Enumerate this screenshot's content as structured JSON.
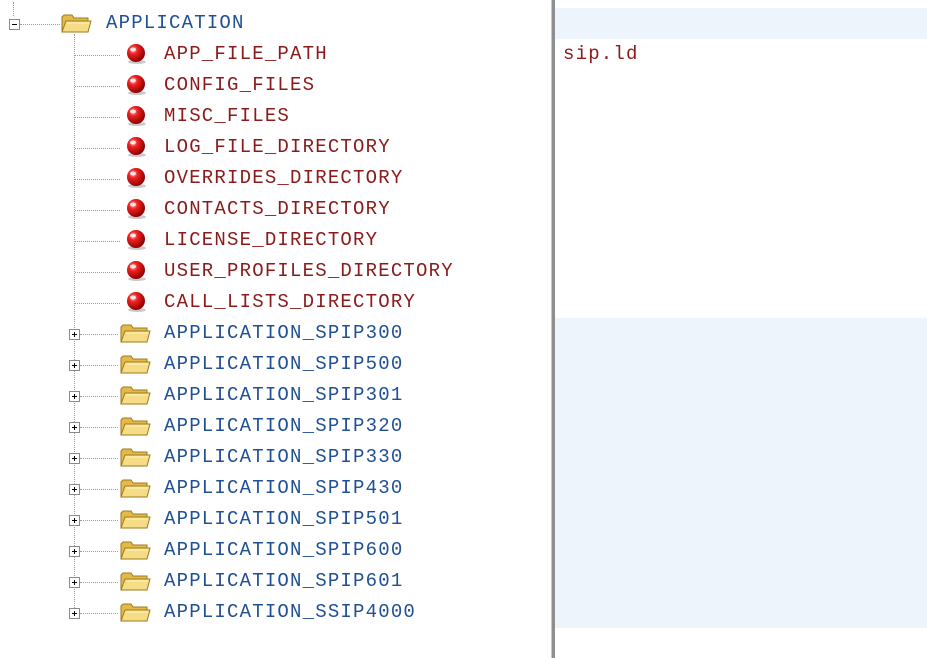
{
  "tree": {
    "root": {
      "label": "APPLICATION",
      "expanded": true,
      "icon": "folder-icon"
    },
    "parameters": [
      {
        "label": "APP_FILE_PATH",
        "icon": "red-ball-icon",
        "value": "sip.ld"
      },
      {
        "label": "CONFIG_FILES",
        "icon": "red-ball-icon",
        "value": ""
      },
      {
        "label": "MISC_FILES",
        "icon": "red-ball-icon",
        "value": ""
      },
      {
        "label": "LOG_FILE_DIRECTORY",
        "icon": "red-ball-icon",
        "value": ""
      },
      {
        "label": "OVERRIDES_DIRECTORY",
        "icon": "red-ball-icon",
        "value": ""
      },
      {
        "label": "CONTACTS_DIRECTORY",
        "icon": "red-ball-icon",
        "value": ""
      },
      {
        "label": "LICENSE_DIRECTORY",
        "icon": "red-ball-icon",
        "value": ""
      },
      {
        "label": "USER_PROFILES_DIRECTORY",
        "icon": "red-ball-icon",
        "value": ""
      },
      {
        "label": "CALL_LISTS_DIRECTORY",
        "icon": "red-ball-icon",
        "value": ""
      }
    ],
    "subfolders": [
      {
        "label": "APPLICATION_SPIP300",
        "expanded": false,
        "icon": "folder-icon"
      },
      {
        "label": "APPLICATION_SPIP500",
        "expanded": false,
        "icon": "folder-icon"
      },
      {
        "label": "APPLICATION_SPIP301",
        "expanded": false,
        "icon": "folder-icon"
      },
      {
        "label": "APPLICATION_SPIP320",
        "expanded": false,
        "icon": "folder-icon"
      },
      {
        "label": "APPLICATION_SPIP330",
        "expanded": false,
        "icon": "folder-icon"
      },
      {
        "label": "APPLICATION_SPIP430",
        "expanded": false,
        "icon": "folder-icon"
      },
      {
        "label": "APPLICATION_SPIP501",
        "expanded": false,
        "icon": "folder-icon"
      },
      {
        "label": "APPLICATION_SPIP600",
        "expanded": false,
        "icon": "folder-icon"
      },
      {
        "label": "APPLICATION_SPIP601",
        "expanded": false,
        "icon": "folder-icon"
      },
      {
        "label": "APPLICATION_SSIP4000",
        "expanded": false,
        "icon": "folder-icon"
      }
    ]
  },
  "colors": {
    "folder_text": "#1f4f94",
    "param_text": "#8b1a1a",
    "folder_row_bg": "#eef4fc",
    "splitter": "#8f8f8f"
  }
}
